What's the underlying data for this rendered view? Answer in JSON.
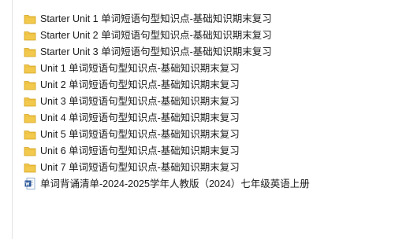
{
  "files": [
    {
      "name": "Starter Unit 1  单词短语句型知识点-基础知识期末复习",
      "icon": "folder-icon"
    },
    {
      "name": "Starter Unit 2  单词短语句型知识点-基础知识期末复习",
      "icon": "folder-icon"
    },
    {
      "name": "Starter Unit 3  单词短语句型知识点-基础知识期末复习",
      "icon": "folder-icon"
    },
    {
      "name": "Unit 1  单词短语句型知识点-基础知识期末复习",
      "icon": "folder-icon"
    },
    {
      "name": "Unit 2  单词短语句型知识点-基础知识期末复习",
      "icon": "folder-icon"
    },
    {
      "name": "Unit 3  单词短语句型知识点-基础知识期末复习",
      "icon": "folder-icon"
    },
    {
      "name": "Unit 4  单词短语句型知识点-基础知识期末复习",
      "icon": "folder-icon"
    },
    {
      "name": "Unit 5  单词短语句型知识点-基础知识期末复习",
      "icon": "folder-icon"
    },
    {
      "name": "Unit 6  单词短语句型知识点-基础知识期末复习",
      "icon": "folder-icon"
    },
    {
      "name": "Unit 7  单词短语句型知识点-基础知识期末复习",
      "icon": "folder-icon"
    },
    {
      "name": "单词背诵清单-2024-2025学年人教版（2024）七年级英语上册",
      "icon": "word-document-icon"
    }
  ],
  "colors": {
    "folder_fill": "#f2c94c",
    "folder_edge": "#d4a21f",
    "word_blue": "#2b5797"
  }
}
